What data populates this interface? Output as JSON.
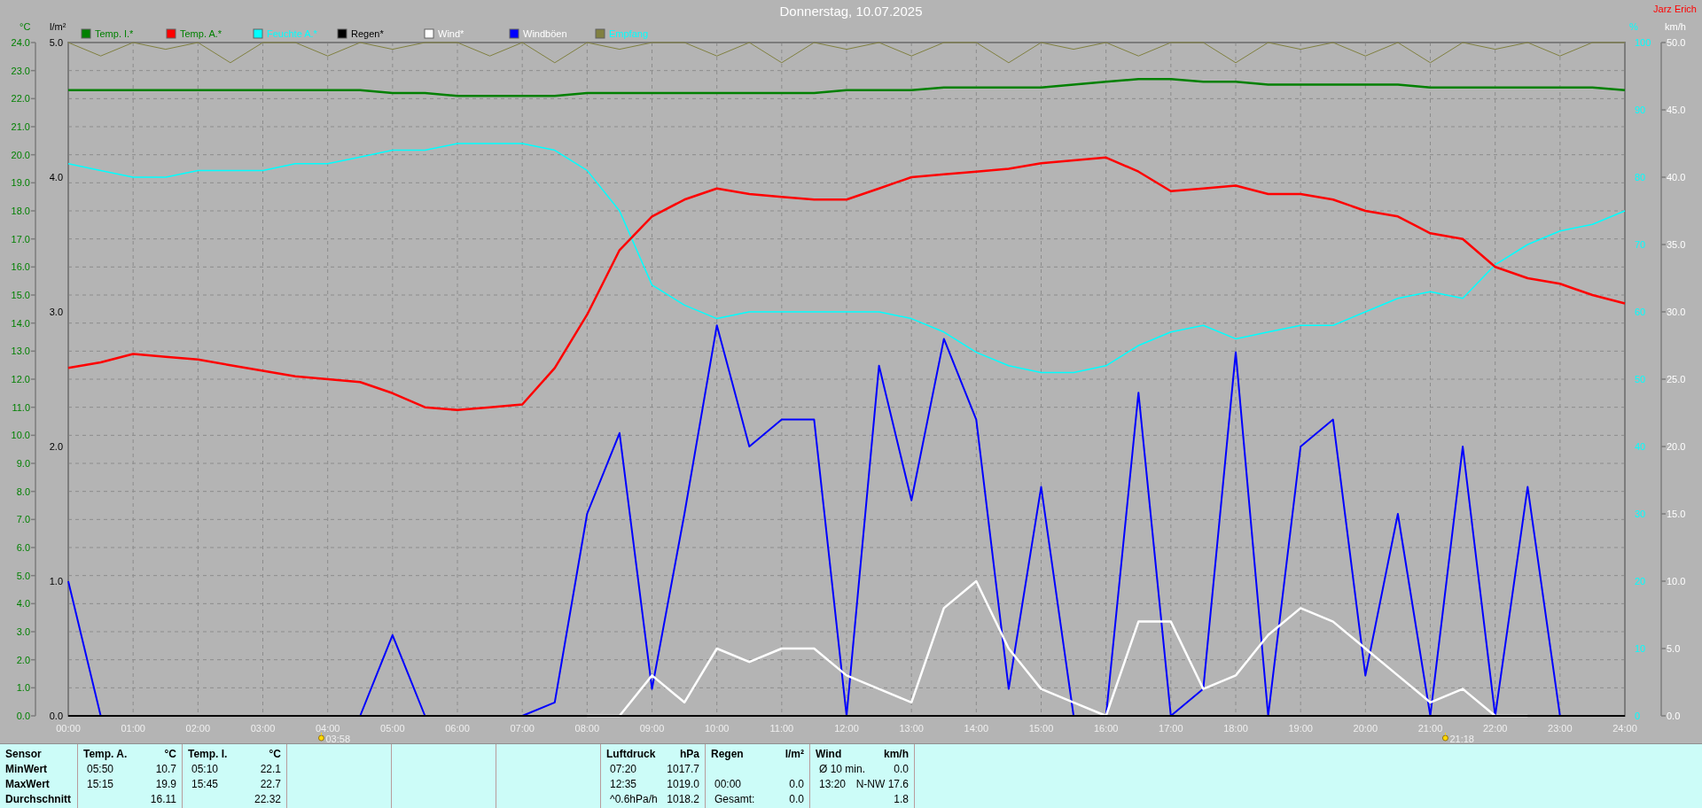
{
  "title": "Donnerstag, 10.07.2025",
  "station": "Jarz Erich",
  "temperature_rain": {
    "chart_data": {
      "type": "line",
      "x": [
        0,
        0.5,
        1,
        1.5,
        2,
        2.5,
        3,
        3.5,
        4,
        4.5,
        5,
        5.5,
        6,
        6.5,
        7,
        7.5,
        8,
        8.5,
        9,
        9.5,
        10,
        10.5,
        11,
        11.5,
        12,
        12.5,
        13,
        13.5,
        14,
        14.5,
        15,
        15.5,
        16,
        16.5,
        17,
        17.5,
        18,
        18.5,
        19,
        19.5,
        20,
        20.5,
        21,
        21.5,
        22,
        22.5,
        23,
        23.5,
        24
      ],
      "xlim": [
        0,
        24
      ],
      "xticks": [
        {
          "value": 0,
          "label": "00:00"
        },
        {
          "value": 1,
          "label": "01:00"
        },
        {
          "value": 2,
          "label": "02:00"
        },
        {
          "value": 3,
          "label": "03:00"
        },
        {
          "value": 4,
          "label": "04:00"
        },
        {
          "value": 5,
          "label": "05:00"
        },
        {
          "value": 6,
          "label": "06:00"
        },
        {
          "value": 7,
          "label": "07:00"
        },
        {
          "value": 8,
          "label": "08:00"
        },
        {
          "value": 9,
          "label": "09:00"
        },
        {
          "value": 10,
          "label": "10:00"
        },
        {
          "value": 11,
          "label": "11:00"
        },
        {
          "value": 12,
          "label": "12:00"
        },
        {
          "value": 13,
          "label": "13:00"
        },
        {
          "value": 14,
          "label": "14:00"
        },
        {
          "value": 15,
          "label": "15:00"
        },
        {
          "value": 16,
          "label": "16:00"
        },
        {
          "value": 17,
          "label": "17:00"
        },
        {
          "value": 18,
          "label": "18:00"
        },
        {
          "value": 19,
          "label": "19:00"
        },
        {
          "value": 20,
          "label": "20:00"
        },
        {
          "value": 21,
          "label": "21:00"
        },
        {
          "value": 22,
          "label": "22:00"
        },
        {
          "value": 23,
          "label": "23:00"
        },
        {
          "value": 24,
          "label": "24:00"
        }
      ],
      "ylabel": "°C",
      "ylim": [
        0,
        24
      ],
      "yticks": [
        {
          "value": 0,
          "label": "0.0"
        },
        {
          "value": 1,
          "label": "1.0"
        },
        {
          "value": 2,
          "label": "2.0"
        },
        {
          "value": 3,
          "label": "3.0"
        },
        {
          "value": 4,
          "label": "4.0"
        },
        {
          "value": 5,
          "label": "5.0"
        },
        {
          "value": 6,
          "label": "6.0"
        },
        {
          "value": 7,
          "label": "7.0"
        },
        {
          "value": 8,
          "label": "8.0"
        },
        {
          "value": 9,
          "label": "9.0"
        },
        {
          "value": 10,
          "label": "10.0"
        },
        {
          "value": 11,
          "label": "11.0"
        },
        {
          "value": 12,
          "label": "12.0"
        },
        {
          "value": 13,
          "label": "13.0"
        },
        {
          "value": 14,
          "label": "14.0"
        },
        {
          "value": 15,
          "label": "15.0"
        },
        {
          "value": 16,
          "label": "16.0"
        },
        {
          "value": 17,
          "label": "17.0"
        },
        {
          "value": 18,
          "label": "18.0"
        },
        {
          "value": 19,
          "label": "19.0"
        },
        {
          "value": 20,
          "label": "20.0"
        },
        {
          "value": 21,
          "label": "21.0"
        },
        {
          "value": 22,
          "label": "22.0"
        },
        {
          "value": 23,
          "label": "23.0"
        },
        {
          "value": 24,
          "label": "24.0"
        }
      ],
      "y2label": "l/m²",
      "y2lim": [
        0,
        5
      ],
      "y2ticks": [
        {
          "value": 0,
          "label": "0.0"
        },
        {
          "value": 1,
          "label": "1.0"
        },
        {
          "value": 2,
          "label": "2.0"
        },
        {
          "value": 3,
          "label": "3.0"
        },
        {
          "value": 4,
          "label": "4.0"
        },
        {
          "value": 5,
          "label": "5.0"
        }
      ],
      "series": [
        {
          "name": "Temp. I.*",
          "color": "#008000",
          "values": [
            22.3,
            22.3,
            22.3,
            22.3,
            22.3,
            22.3,
            22.3,
            22.3,
            22.3,
            22.3,
            22.2,
            22.2,
            22.1,
            22.1,
            22.1,
            22.1,
            22.2,
            22.2,
            22.2,
            22.2,
            22.2,
            22.2,
            22.2,
            22.2,
            22.3,
            22.3,
            22.3,
            22.4,
            22.4,
            22.4,
            22.4,
            22.5,
            22.6,
            22.7,
            22.7,
            22.6,
            22.6,
            22.5,
            22.5,
            22.5,
            22.5,
            22.5,
            22.4,
            22.4,
            22.4,
            22.4,
            22.4,
            22.4,
            22.3
          ]
        },
        {
          "name": "Temp. A.*",
          "color": "#ff0000",
          "values": [
            12.4,
            12.6,
            12.9,
            12.8,
            12.7,
            12.5,
            12.3,
            12.1,
            12.0,
            11.9,
            11.5,
            11.0,
            10.9,
            11.0,
            11.1,
            12.4,
            14.3,
            16.6,
            17.8,
            18.4,
            18.8,
            18.6,
            18.5,
            18.4,
            18.4,
            18.8,
            19.2,
            19.3,
            19.4,
            19.5,
            19.7,
            19.8,
            19.9,
            19.4,
            18.7,
            18.8,
            18.9,
            18.6,
            18.6,
            18.4,
            18.0,
            17.8,
            17.2,
            17.0,
            16.0,
            15.6,
            15.4,
            15.0,
            14.7
          ]
        },
        {
          "name": "Regen*",
          "color": "#000000",
          "values": [
            0,
            0,
            0,
            0,
            0,
            0,
            0,
            0,
            0,
            0,
            0,
            0,
            0,
            0,
            0,
            0,
            0,
            0,
            0,
            0,
            0,
            0,
            0,
            0,
            0,
            0,
            0,
            0,
            0,
            0,
            0,
            0,
            0,
            0,
            0,
            0,
            0,
            0,
            0,
            0,
            0,
            0,
            0,
            0,
            0,
            0,
            0,
            0,
            0
          ]
        }
      ],
      "annotations": [
        {
          "x": 3.97,
          "y": 0,
          "text": "03:58"
        },
        {
          "x": 21.3,
          "y": 0,
          "text": "21:18"
        }
      ]
    }
  },
  "humidity_wind": {
    "chart_data": {
      "type": "line",
      "x": [
        0,
        0.5,
        1,
        1.5,
        2,
        2.5,
        3,
        3.5,
        4,
        4.5,
        5,
        5.5,
        6,
        6.5,
        7,
        7.5,
        8,
        8.5,
        9,
        9.5,
        10,
        10.5,
        11,
        11.5,
        12,
        12.5,
        13,
        13.5,
        14,
        14.5,
        15,
        15.5,
        16,
        16.5,
        17,
        17.5,
        18,
        18.5,
        19,
        19.5,
        20,
        20.5,
        21,
        21.5,
        22,
        22.5,
        23,
        23.5,
        24
      ],
      "xlim": [
        0,
        24
      ],
      "ylabel": "km/h",
      "ylim": [
        0,
        50
      ],
      "yticks": [
        {
          "value": 0,
          "label": "0.0"
        },
        {
          "value": 5,
          "label": "5.0"
        },
        {
          "value": 10,
          "label": "10.0"
        },
        {
          "value": 15,
          "label": "15.0"
        },
        {
          "value": 20,
          "label": "20.0"
        },
        {
          "value": 25,
          "label": "25.0"
        },
        {
          "value": 30,
          "label": "30.0"
        },
        {
          "value": 35,
          "label": "35.0"
        },
        {
          "value": 40,
          "label": "40.0"
        },
        {
          "value": 45,
          "label": "45.0"
        },
        {
          "value": 50,
          "label": "50.0"
        }
      ],
      "y2label": "%",
      "y2lim": [
        0,
        100
      ],
      "y2ticks": [
        {
          "value": 0,
          "label": "0"
        },
        {
          "value": 10,
          "label": "10"
        },
        {
          "value": 20,
          "label": "20"
        },
        {
          "value": 30,
          "label": "30"
        },
        {
          "value": 40,
          "label": "40"
        },
        {
          "value": 50,
          "label": "50"
        },
        {
          "value": 60,
          "label": "60"
        },
        {
          "value": 70,
          "label": "70"
        },
        {
          "value": 80,
          "label": "80"
        },
        {
          "value": 90,
          "label": "90"
        },
        {
          "value": 100,
          "label": "100"
        }
      ],
      "series": [
        {
          "name": "Feuchte A.*",
          "color": "#00ffff",
          "axis": "y2",
          "values": [
            82,
            81,
            80,
            80,
            81,
            81,
            81,
            82,
            82,
            83,
            84,
            84,
            85,
            85,
            85,
            84,
            81,
            75,
            64,
            61,
            59,
            60,
            60,
            60,
            60,
            60,
            59,
            57,
            54,
            52,
            51,
            51,
            52,
            55,
            57,
            58,
            56,
            57,
            58,
            58,
            60,
            62,
            63,
            62,
            67,
            70,
            72,
            73,
            75
          ]
        },
        {
          "name": "Wind*",
          "color": "#ffffff",
          "values": [
            null,
            null,
            null,
            null,
            null,
            null,
            null,
            null,
            null,
            null,
            null,
            null,
            null,
            null,
            null,
            null,
            0,
            0,
            3,
            1,
            5,
            4,
            5,
            5,
            3,
            2,
            1,
            8,
            10,
            5,
            2,
            1,
            0,
            7,
            7,
            2,
            3,
            6,
            8,
            7,
            5,
            3,
            1,
            2,
            0,
            0,
            null,
            null,
            null
          ]
        },
        {
          "name": "Windböen",
          "color": "#0000ff",
          "values": [
            10,
            0,
            0,
            0,
            0,
            0,
            0,
            0,
            0,
            0,
            6,
            0,
            0,
            0,
            0,
            1,
            15,
            21,
            2,
            15,
            29,
            20,
            22,
            22,
            0,
            26,
            16,
            28,
            22,
            2,
            17,
            0,
            0,
            24,
            0,
            2,
            27,
            0,
            20,
            22,
            3,
            15,
            0,
            20,
            0,
            17,
            0,
            0,
            0
          ]
        },
        {
          "name": "Empfang",
          "color": "#808040",
          "axis": "y2",
          "values": [
            100,
            98,
            100,
            99,
            100,
            97,
            100,
            100,
            98,
            100,
            99,
            100,
            100,
            98,
            100,
            97,
            100,
            99,
            100,
            100,
            98,
            100,
            97,
            100,
            99,
            100,
            98,
            100,
            100,
            97,
            100,
            99,
            100,
            98,
            100,
            100,
            97,
            100,
            99,
            100,
            98,
            100,
            97,
            100,
            99,
            100,
            98,
            100,
            100
          ]
        }
      ]
    }
  },
  "table": {
    "columns": [
      {
        "kind": "labels",
        "header": "Sensor",
        "rows": [
          "MinWert",
          "MaxWert",
          "Durchschnitt"
        ]
      },
      {
        "kind": "data",
        "header": "Temp. A.",
        "unit": "°C",
        "rows": [
          {
            "time": "05:50",
            "value": "10.7"
          },
          {
            "time": "15:15",
            "value": "19.9"
          },
          {
            "value": "16.11"
          }
        ]
      },
      {
        "kind": "data",
        "header": "Temp. I.",
        "unit": "°C",
        "rows": [
          {
            "time": "05:10",
            "value": "22.1"
          },
          {
            "time": "15:45",
            "value": "22.7"
          },
          {
            "value": "22.32"
          }
        ]
      },
      {
        "kind": "empty"
      },
      {
        "kind": "empty"
      },
      {
        "kind": "empty"
      },
      {
        "kind": "data",
        "header": "Luftdruck",
        "unit": "hPa",
        "rows": [
          {
            "time": "07:20",
            "value": "1017.7"
          },
          {
            "time": "12:35",
            "value": "1019.0"
          },
          {
            "time": "^0.6hPa/h",
            "value": "1018.2"
          }
        ]
      },
      {
        "kind": "data",
        "header": "Regen",
        "unit": "l/m²",
        "rows": [
          {},
          {
            "time": "00:00",
            "value": "0.0"
          },
          {
            "time": "Gesamt:",
            "value": "0.0"
          }
        ]
      },
      {
        "kind": "data",
        "header": "Wind",
        "unit": "km/h",
        "rows": [
          {
            "time": "Ø 10 min.",
            "value": "0.0"
          },
          {
            "time": "13:20",
            "value": "N-NW 17.6"
          },
          {
            "value": "1.8"
          }
        ]
      }
    ]
  }
}
